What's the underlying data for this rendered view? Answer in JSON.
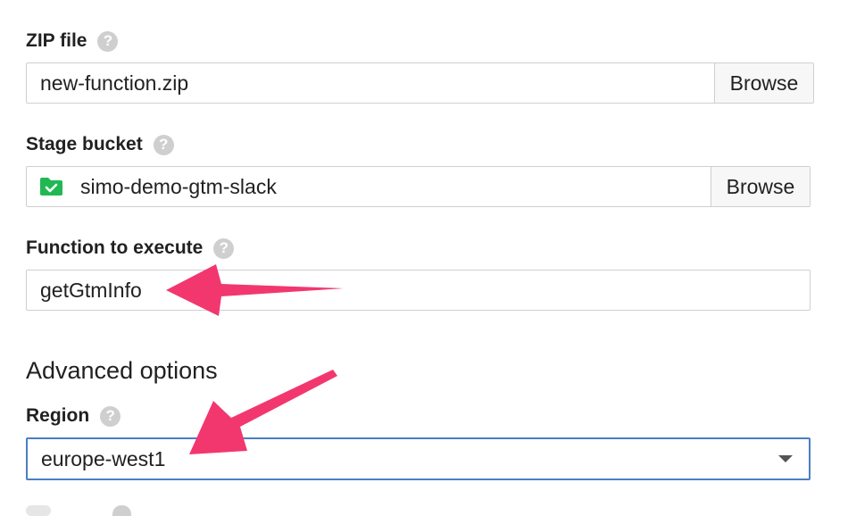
{
  "zip": {
    "label": "ZIP file",
    "value": "new-function.zip",
    "browse": "Browse"
  },
  "bucket": {
    "label": "Stage bucket",
    "value": "simo-demo-gtm-slack",
    "browse": "Browse"
  },
  "function": {
    "label": "Function to execute",
    "value": "getGtmInfo"
  },
  "advanced": {
    "title": "Advanced options"
  },
  "region": {
    "label": "Region",
    "value": "europe-west1"
  },
  "help_icon": "question-mark",
  "colors": {
    "arrow": "#f2376f",
    "bucket_icon": "#21b854",
    "select_border": "#4a7fc4"
  }
}
